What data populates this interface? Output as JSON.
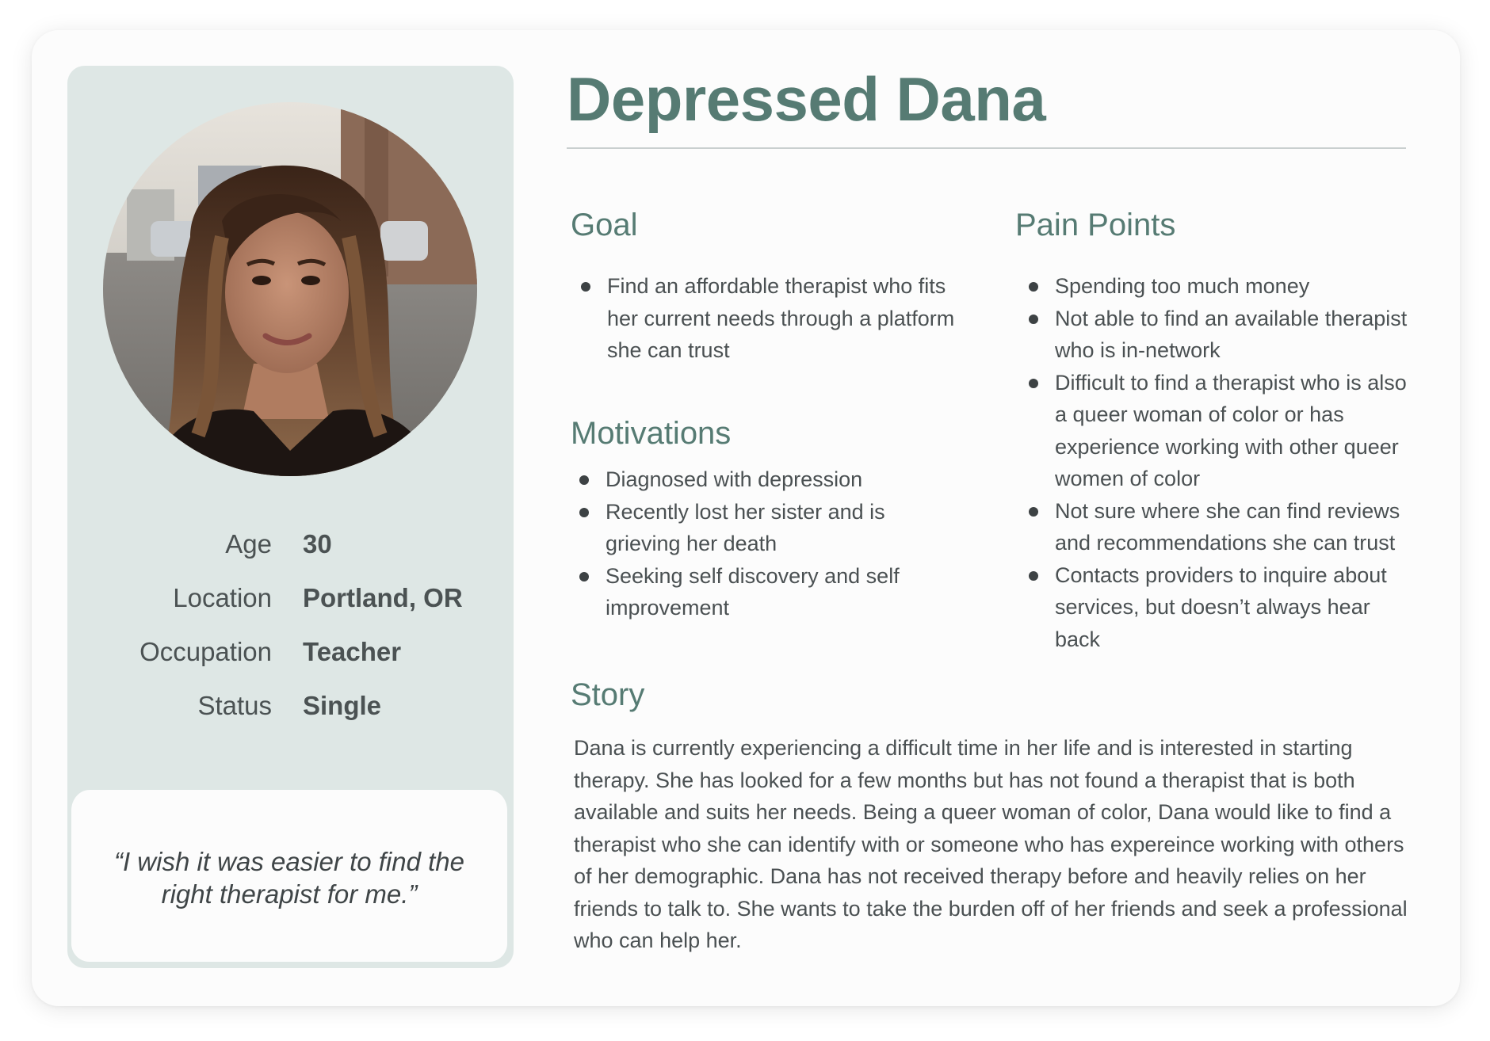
{
  "persona": {
    "name": "Depressed Dana",
    "facts": [
      {
        "label": "Age",
        "value": "30"
      },
      {
        "label": "Location",
        "value": "Portland, OR"
      },
      {
        "label": "Occupation",
        "value": "Teacher"
      },
      {
        "label": "Status",
        "value": "Single"
      }
    ],
    "quote": "“I wish it was easier to find the right therapist for me.”"
  },
  "sections": {
    "goal": {
      "heading": "Goal",
      "items": [
        "Find an affordable therapist who fits her current needs through a platform she can trust"
      ]
    },
    "motivations": {
      "heading": "Motivations",
      "items": [
        "Diagnosed with depression",
        "Recently lost her sister and is grieving her death",
        "Seeking self discovery and self improvement"
      ]
    },
    "pain_points": {
      "heading": "Pain Points",
      "items": [
        "Spending too much money",
        "Not able to find an available therapist who is in-network",
        "Difficult to find a therapist who is also a queer woman of color or has experience working with other queer women of color",
        "Not sure where she can find reviews and recommendations she can trust",
        "Contacts providers to inquire about services, but doesn’t always hear back"
      ]
    },
    "story": {
      "heading": "Story",
      "text": "Dana is currently experiencing a difficult time in her life and is interested in starting therapy. She has looked for a few months but has not found a therapist that is both available and suits her needs. Being a queer woman of color, Dana would like to find a therapist who she can identify with or someone who has expereince working with others of her demographic. Dana has not received therapy before and heavily relies on her friends to talk to. She wants to take the burden off of her friends and seek a professional who can help her."
    }
  },
  "colors": {
    "accent": "#567b73",
    "panel": "#dee7e5",
    "text": "#4a5052"
  }
}
